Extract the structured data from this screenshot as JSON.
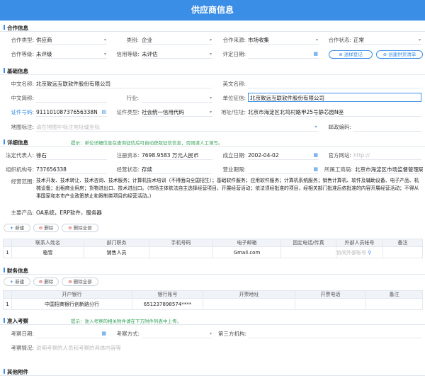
{
  "page": {
    "title": "供应商信息"
  },
  "sections": {
    "coop": {
      "title": "合作信息"
    },
    "basic": {
      "title": "基础信息"
    },
    "detail": {
      "title": "详细信息",
      "notice": "提示：单位详细信息在查询征信后可自动获取征信信息，否则请人工填写。"
    },
    "finance": {
      "title": "财务信息"
    },
    "inspect": {
      "title": "准入考察",
      "notice": "提示：准入考察的相关附件请在下方附件列表中上传。"
    },
    "attach": {
      "title": "其他附件"
    }
  },
  "coop": {
    "type_label": "合作类型:",
    "type_value": "供应商",
    "category_label": "类别:",
    "category_value": "企业",
    "source_label": "合作来源:",
    "source_value": "市场收集",
    "status_label": "合作状态:",
    "status_value": "正常",
    "level_label": "合作等级:",
    "level_value": "未评级",
    "credit_label": "信用等级:",
    "credit_value": "未评估",
    "review_date_label": "评定日期:",
    "visit_btn": "送样登记",
    "create_btn": "创建供货清单"
  },
  "basic": {
    "cn_name_label": "中文名称:",
    "cn_name_value": "北京致远互联软件股份有限公司",
    "en_name_label": "英文名称:",
    "short_label": "中文简称:",
    "industry_label": "行业:",
    "credit_query_label": "单位征信:",
    "credit_query_value": "北京致远互联软件股份有限公司",
    "cert_no_label": "证件号码:",
    "cert_no_value": "91110108737656338N",
    "cert_type_label": "证件类型:",
    "cert_type_value": "社会统一信用代码",
    "address_label": "地址/住址:",
    "address_value": "北京市海淀区北坞村路甲25号静芯园N座",
    "map_label": "地图标注:",
    "map_placeholder": "请在地图中标注地址或坐标",
    "postcode_label": "邮政编码:"
  },
  "detail": {
    "legal_label": "法定代表人:",
    "legal_value": "徐石",
    "capital_label": "注册资本:",
    "capital_value": "7698.9583 万元人民币",
    "founded_label": "成立日期:",
    "founded_value": "2002-04-02",
    "website_label": "官方网站:",
    "website_value": "http://",
    "org_label": "组织机构号:",
    "org_value": "737656338",
    "op_status_label": "经营状态:",
    "op_status_value": "存续",
    "op_term_label": "营业期限:",
    "bureau_label": "所属工商局:",
    "bureau_value": "北京市海淀区市场监督管理局",
    "scope_label": "经营范围:",
    "scope_value": "技术开发、技术转让、技术咨询、技术服务；计算机技术培训（不得面向全国招生）；基础软件服务；应用软件服务；计算机系统服务；销售计算机、软件及辅助设备、电子产品、机械设备；出租商业用房；货物进出口、技术进出口。（市场主体依法自主选择经营项目，开展经营活动；依法须经批准的项目，经相关部门批准后依批准的内容开展经营活动；不得从事国家和本市产业政策禁止和限制类项目的经营活动。）",
    "products_label": "主要产品:",
    "products_value": "OA系统，ERP软件，服务器"
  },
  "toolbar": {
    "add": "新建",
    "delete": "删除",
    "delete_all": "删除全部"
  },
  "contacts": {
    "headers": [
      "联系人姓名",
      "部门职务",
      "手机号码",
      "电子邮箱",
      "固定电话/传真",
      "外部人员帐号",
      "备注"
    ],
    "rows": [
      {
        "no": "1",
        "name": "骆雪",
        "dept": "销售人员",
        "mobile": "",
        "email": "Gmail.com",
        "phone": "",
        "account_placeholder": "协同外部账号",
        "note": ""
      }
    ]
  },
  "finance": {
    "headers": [
      "开户银行",
      "银行账号",
      "开票地址",
      "开票电话",
      "备注"
    ],
    "rows": [
      {
        "no": "1",
        "bank": "中国招商银行创新路分行",
        "account": "651237898574****",
        "addr": "",
        "phone": "",
        "note": ""
      }
    ]
  },
  "inspect": {
    "date_label": "考察日期:",
    "method_label": "考察方式:",
    "third_label": "第三方机构:",
    "desc_label": "考察情况:",
    "desc_placeholder": "说明考察的人员和考察的具体内容等"
  },
  "colors": {
    "primary": "#3a8ee6",
    "notice": "#35a05a"
  }
}
